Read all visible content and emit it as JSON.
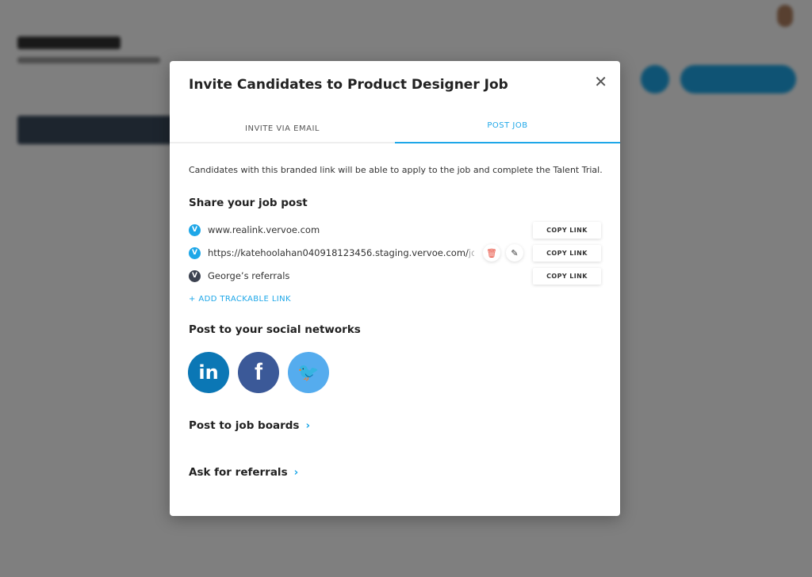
{
  "modal": {
    "title": "Invite Candidates to Product Designer Job",
    "close": "✕",
    "tabs": [
      {
        "label": "INVITE VIA EMAIL"
      },
      {
        "label": "POST JOB"
      }
    ],
    "description": "Candidates with this branded link will be able to apply to the job and complete the Talent Trial.",
    "share_heading": "Share your job post",
    "links": [
      {
        "url": "www.realink.vervoe.com",
        "copy": "COPY LINK"
      },
      {
        "url": "https://katehoolahan040918123456.staging.vervoe.com/",
        "url_faded": "job-o",
        "copy": "COPY LINK"
      },
      {
        "url": "George’s referrals",
        "copy": "COPY LINK"
      }
    ],
    "add_link": "+ ADD TRACKABLE LINK",
    "social_heading": "Post to your social networks",
    "social": [
      {
        "name": "linkedin",
        "glyph": "in",
        "color": "#0b77b5"
      },
      {
        "name": "facebook",
        "glyph": "f",
        "color": "#3b5998"
      },
      {
        "name": "twitter",
        "glyph": "🐦",
        "color": "#55acee"
      }
    ],
    "job_boards": "Post to job boards",
    "referrals": "Ask for referrals",
    "chevron": "›"
  },
  "colors": {
    "accent": "#1ea7e8",
    "delete": "#e74c3c"
  }
}
